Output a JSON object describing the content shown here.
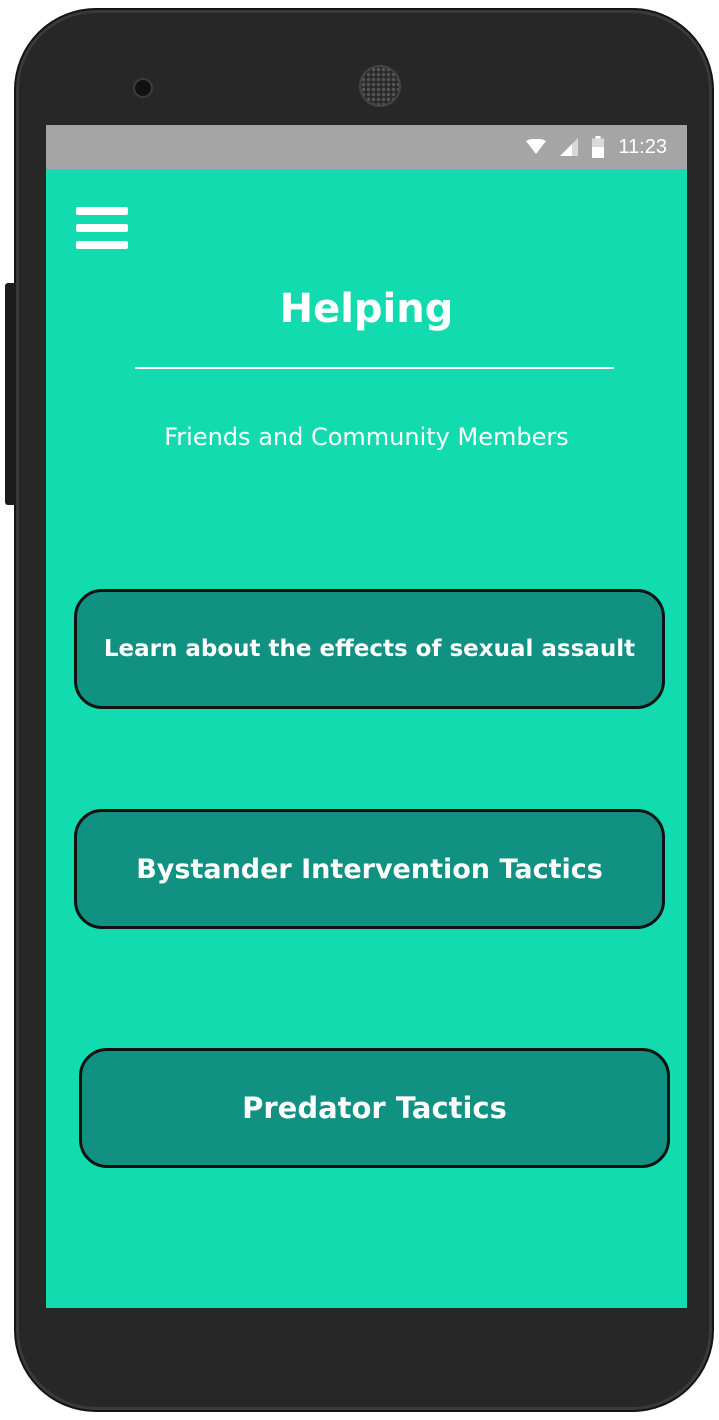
{
  "status_bar": {
    "time": "11:23",
    "icons": [
      "wifi-icon",
      "signal-icon",
      "battery-icon"
    ]
  },
  "header": {
    "menu_icon": "hamburger-menu-icon",
    "title": "Helping",
    "subtitle": "Friends and Community Members"
  },
  "menu": {
    "items": [
      {
        "label": "Learn about the effects of sexual assault"
      },
      {
        "label": "Bystander Intervention Tactics"
      },
      {
        "label": "Predator Tactics"
      }
    ]
  },
  "colors": {
    "background": "#12dbb0",
    "button": "#109181",
    "status_bar": "#a5a5a5",
    "text": "#ffffff"
  }
}
